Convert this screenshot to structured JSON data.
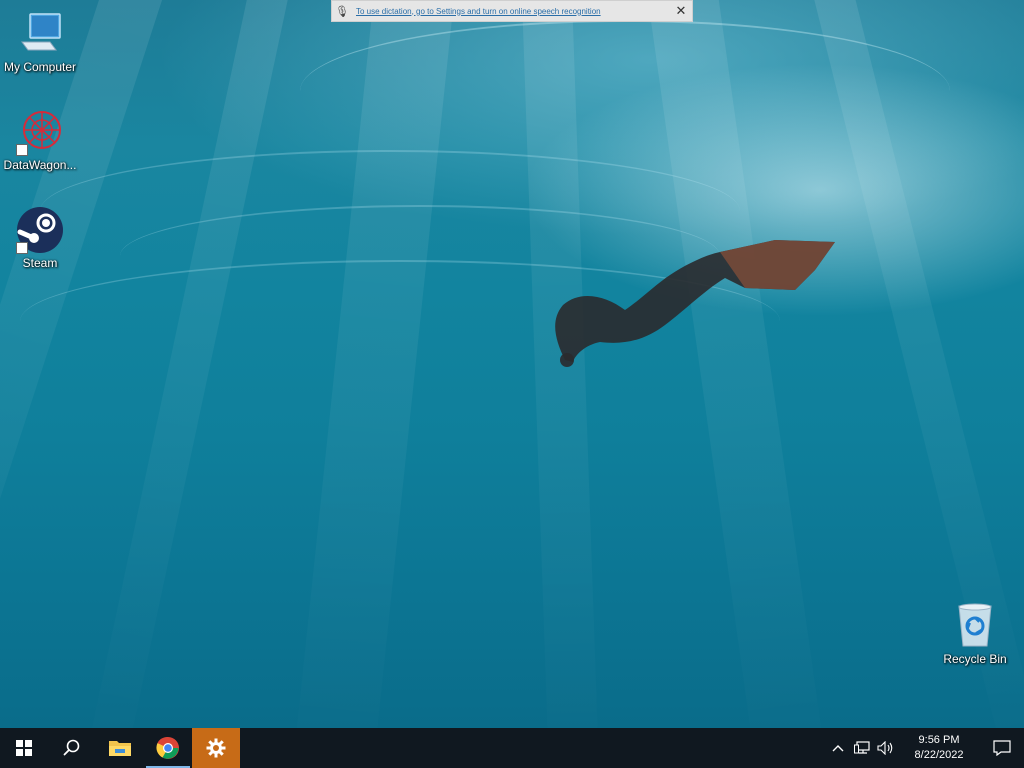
{
  "notification": {
    "message": "To use dictation, go to Settings and turn on online speech recognition",
    "mic_icon": "microphone-icon",
    "close_label": "✕"
  },
  "desktop_icons": [
    {
      "label": "My Computer",
      "icon": "computer-icon"
    },
    {
      "label": "DataWagon...",
      "icon": "datawagon-icon"
    },
    {
      "label": "Steam",
      "icon": "steam-icon"
    },
    {
      "label": "Recycle Bin",
      "icon": "recycle-bin-icon"
    }
  ],
  "taskbar": {
    "start_icon": "windows-start-icon",
    "search_icon": "search-icon",
    "apps": [
      {
        "name": "File Explorer",
        "icon": "file-explorer-icon",
        "open": false
      },
      {
        "name": "Google Chrome",
        "icon": "chrome-icon",
        "open": true
      },
      {
        "name": "Settings",
        "icon": "gear-icon",
        "active": true
      }
    ],
    "tray": {
      "chevron_icon": "chevron-up-icon",
      "network_icon": "network-icon",
      "volume_icon": "volume-icon",
      "time": "9:56 PM",
      "date": "8/22/2022",
      "notification_icon": "action-center-icon"
    }
  },
  "colors": {
    "taskbar_bg": "#101820",
    "settings_highlight": "#c76b17",
    "notification_link": "#2a6ea8"
  }
}
